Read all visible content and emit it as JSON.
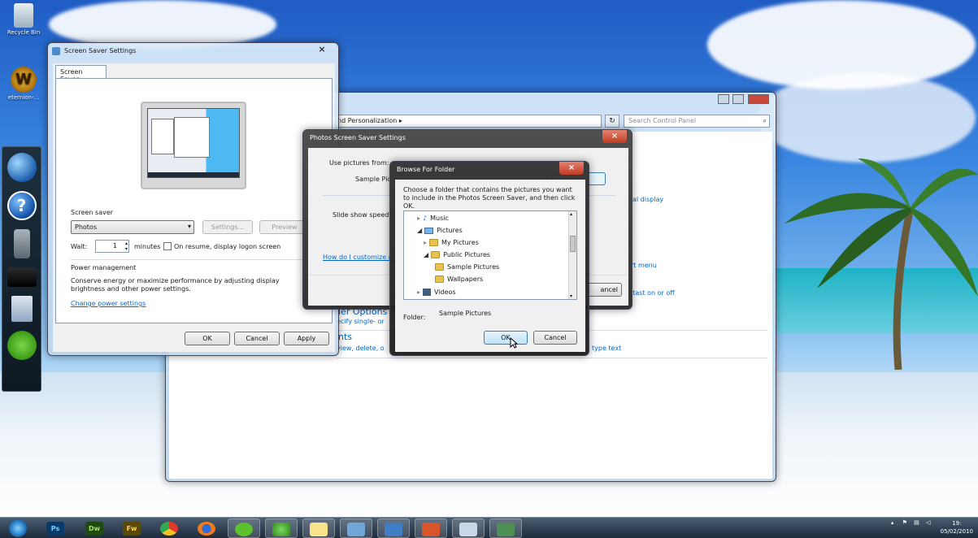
{
  "desktop": {
    "icons": [
      {
        "label": "Recycle Bin",
        "icon": "recycle-bin-icon"
      },
      {
        "label": "eternion-...",
        "icon": "wow-shortcut-icon"
      }
    ],
    "gadgets": [
      "globe-icon",
      "help-icon",
      "pencil-cup-icon",
      "camera-icon",
      "calendar-icon",
      "spotify-icon"
    ]
  },
  "screen_saver_settings": {
    "title": "Screen Saver Settings",
    "close": "×",
    "tab": "Screen Saver",
    "screen_saver_label": "Screen saver",
    "selected": "Photos",
    "settings_btn": "Settings...",
    "preview_btn": "Preview",
    "wait_label": "Wait:",
    "wait_value": "1",
    "minutes_label": "minutes",
    "resume_label": "On resume, display logon screen",
    "power_title": "Power management",
    "power_desc": "Conserve energy or maximize performance by adjusting display brightness and other power settings.",
    "power_link": "Change power settings",
    "ok": "OK",
    "cancel": "Cancel",
    "apply": "Apply"
  },
  "control_panel": {
    "breadcrumb": "nd Personalization",
    "search_placeholder": "Search Control Panel",
    "links": [
      "al display",
      "rt menu",
      "itast on or off",
      "type text"
    ],
    "partials": [
      "ler Options",
      "ecify single- or",
      "nts",
      "view, delete, o"
    ]
  },
  "photos_settings": {
    "title": "Photos Screen Saver Settings",
    "use_pictures": "Use pictures from:",
    "sample_prefix": "Sample Pic",
    "slide_speed": "Slide show speed:",
    "customize_link": "How do I customize m",
    "cancel_partial": "ancel"
  },
  "browse_folder": {
    "title": "Browse For Folder",
    "close": "×",
    "instructions": "Choose a folder that contains the pictures you want to include in the Photos Screen Saver, and then click OK.",
    "tree": [
      "Music",
      "Pictures",
      "My Pictures",
      "Public Pictures",
      "Sample Pictures",
      "Wallpapers",
      "Videos"
    ],
    "folder_label": "Folder:",
    "folder_value": "Sample Pictures",
    "ok": "OK",
    "cancel": "Cancel"
  },
  "taskbar": {
    "apps": [
      "start-orb",
      "Ps",
      "Dw",
      "Fw",
      "chrome-icon",
      "firefox-icon",
      "spotify-icon",
      "messenger-icon",
      "notes-icon",
      "control-panel-icon",
      "screen-icon",
      "powerpoint-icon",
      "paint-icon",
      "display-icon"
    ],
    "time": "19:",
    "date": "05/02/2010"
  }
}
